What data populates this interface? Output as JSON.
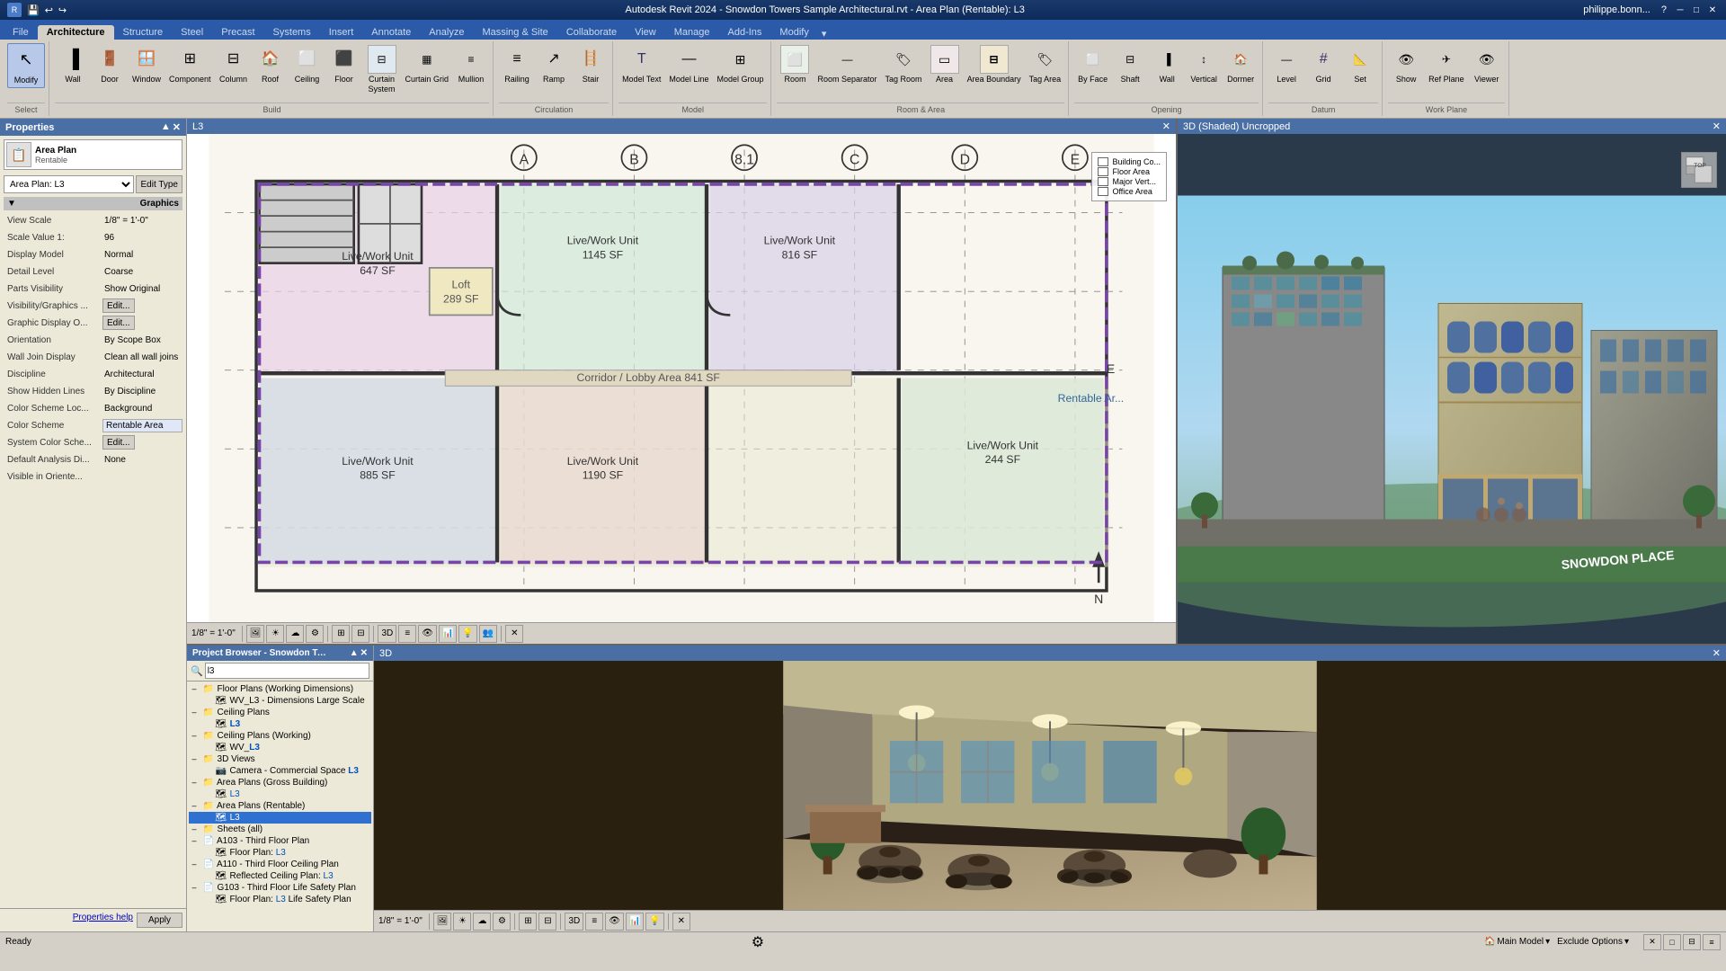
{
  "app": {
    "title": "Autodesk Revit 2024 - Snowdon Towers Sample Architectural.rvt - Area Plan (Rentable): L3",
    "user": "philippe.bonn...",
    "version": "2024"
  },
  "quick_toolbar": {
    "buttons": [
      "🖫",
      "📂",
      "💾",
      "↩",
      "↪",
      "?"
    ]
  },
  "ribbon": {
    "active_tab": "Architecture",
    "tabs": [
      "File",
      "Architecture",
      "Structure",
      "Steel",
      "Precast",
      "Systems",
      "Insert",
      "Annotate",
      "Analyze",
      "Massing & Site",
      "Collaborate",
      "View",
      "Manage",
      "Add-Ins",
      "Modify"
    ],
    "groups": {
      "select": {
        "label": "Select",
        "buttons": [
          {
            "icon": "↖",
            "label": "Modify"
          }
        ]
      },
      "build": {
        "label": "Build",
        "buttons": [
          {
            "icon": "🧱",
            "label": "Wall"
          },
          {
            "icon": "🚪",
            "label": "Door"
          },
          {
            "icon": "🪟",
            "label": "Window"
          },
          {
            "icon": "⊞",
            "label": "Component"
          },
          {
            "icon": "🏛",
            "label": "Column"
          },
          {
            "icon": "🏠",
            "label": "Roof"
          },
          {
            "icon": "⬜",
            "label": "Ceiling"
          },
          {
            "icon": "⬛",
            "label": "Floor"
          },
          {
            "icon": "⊟",
            "label": "Curtain System"
          },
          {
            "icon": "⊞",
            "label": "Curtain Grid"
          },
          {
            "icon": "▦",
            "label": "Mullion"
          }
        ]
      },
      "circulation": {
        "label": "Circulation",
        "buttons": [
          {
            "icon": "⊟",
            "label": "Railing"
          },
          {
            "icon": "↗",
            "label": "Ramp"
          },
          {
            "icon": "≡",
            "label": "Stair"
          }
        ]
      },
      "model": {
        "label": "Model",
        "buttons": [
          {
            "icon": "T",
            "label": "Model Text"
          },
          {
            "icon": "—",
            "label": "Model Line"
          },
          {
            "icon": "⊞",
            "label": "Model Group"
          }
        ]
      },
      "room_area": {
        "label": "Room & Area",
        "buttons": [
          {
            "icon": "⬜",
            "label": "Room"
          },
          {
            "icon": "🏠",
            "label": "Room Separator"
          },
          {
            "icon": "🏷",
            "label": "Tag Room"
          },
          {
            "icon": "▭",
            "label": "Area"
          },
          {
            "icon": "⊟",
            "label": "Area Boundary"
          },
          {
            "icon": "🏷",
            "label": "Tag Area"
          }
        ]
      },
      "opening": {
        "label": "Opening",
        "buttons": [
          {
            "icon": "⬜",
            "label": "By Face"
          },
          {
            "icon": "⊟",
            "label": "Shaft"
          },
          {
            "icon": "🧱",
            "label": "Wall"
          },
          {
            "icon": "↕",
            "label": "Vertical"
          },
          {
            "icon": "⬛",
            "label": "Dormer"
          }
        ]
      },
      "datum": {
        "label": "Datum",
        "buttons": [
          {
            "icon": "—",
            "label": "Level"
          },
          {
            "icon": "#",
            "label": "Grid"
          },
          {
            "icon": "📐",
            "label": "Set"
          }
        ]
      },
      "work_plane": {
        "label": "Work Plane",
        "buttons": [
          {
            "icon": "👁",
            "label": "Show"
          },
          {
            "icon": "✈",
            "label": "Ref Plane"
          },
          {
            "icon": "👁",
            "label": "Viewer"
          }
        ]
      }
    }
  },
  "properties": {
    "title": "Properties",
    "type_name": "Area Plan",
    "type_sub": "Rentable",
    "selector_label": "Area Plan: L3",
    "edit_type_btn": "Edit Type",
    "sections": {
      "graphics": {
        "label": "Graphics",
        "expanded": true,
        "rows": [
          {
            "label": "View Scale",
            "value": "1/8\" = 1'-0\""
          },
          {
            "label": "Scale Value  1:",
            "value": "96"
          },
          {
            "label": "Display Model",
            "value": "Normal"
          },
          {
            "label": "Detail Level",
            "value": "Coarse"
          },
          {
            "label": "Parts Visibility",
            "value": "Show Original"
          },
          {
            "label": "Visibility/Graphics ...",
            "value": "Edit..."
          },
          {
            "label": "Graphic Display O...",
            "value": "Edit..."
          },
          {
            "label": "Orientation",
            "value": "By Scope Box"
          },
          {
            "label": "Wall Join Display",
            "value": "Clean all wall joins"
          },
          {
            "label": "Discipline",
            "value": "Architectural"
          },
          {
            "label": "Show Hidden Lines",
            "value": "By Discipline"
          },
          {
            "label": "Color Scheme Loc...",
            "value": "Background"
          },
          {
            "label": "Color Scheme",
            "value": "Rentable Area"
          },
          {
            "label": "System Color Sche...",
            "value": "Edit..."
          },
          {
            "label": "Default Analysis Di...",
            "value": "None"
          },
          {
            "label": "Visible in Oriente...",
            "value": ""
          }
        ]
      }
    },
    "footer": {
      "apply_label": "Apply",
      "help_link": "Properties help"
    }
  },
  "plan_view": {
    "title": "L3",
    "scale": "1/8\" = 1'-0\"",
    "legend": {
      "items": [
        {
          "label": "Building Co...",
          "checked": false
        },
        {
          "label": "Floor Area",
          "checked": false
        },
        {
          "label": "Major Vert...",
          "checked": false
        },
        {
          "label": "Office Area",
          "checked": false
        }
      ]
    }
  },
  "view_3d_top": {
    "title": "3D (Shaded) Uncropped"
  },
  "project_browser": {
    "title": "Project Browser - Snowdon Towers Sample A...",
    "search_placeholder": "13",
    "tree": [
      {
        "indent": 0,
        "expand": "–",
        "icon": "📁",
        "label": "Floor Plans (Working Dimensions)",
        "selected": false
      },
      {
        "indent": 1,
        "expand": "",
        "icon": "🗺",
        "label": "WV_L3 - Dimensions Large Scale",
        "selected": false
      },
      {
        "indent": 0,
        "expand": "–",
        "icon": "📁",
        "label": "Ceiling Plans",
        "selected": false
      },
      {
        "indent": 1,
        "expand": "",
        "icon": "🗺",
        "label": "L3",
        "selected": false,
        "blue_tag": "L3"
      },
      {
        "indent": 0,
        "expand": "–",
        "icon": "📁",
        "label": "Ceiling Plans (Working)",
        "selected": false
      },
      {
        "indent": 1,
        "expand": "",
        "icon": "🗺",
        "label": "WV_L3",
        "selected": false
      },
      {
        "indent": 0,
        "expand": "–",
        "icon": "📁",
        "label": "3D Views",
        "selected": false
      },
      {
        "indent": 1,
        "expand": "",
        "icon": "📷",
        "label": "Camera - Commercial Space L3",
        "selected": false
      },
      {
        "indent": 0,
        "expand": "–",
        "icon": "📁",
        "label": "Area Plans (Gross Building)",
        "selected": false
      },
      {
        "indent": 1,
        "expand": "",
        "icon": "🗺",
        "label": "L3",
        "selected": false
      },
      {
        "indent": 0,
        "expand": "–",
        "icon": "📁",
        "label": "Area Plans (Rentable)",
        "selected": false
      },
      {
        "indent": 1,
        "expand": "",
        "icon": "🗺",
        "label": "L3",
        "selected": true
      },
      {
        "indent": 0,
        "expand": "–",
        "icon": "📁",
        "label": "Sheets (all)",
        "selected": false
      },
      {
        "indent": 0,
        "expand": "–",
        "icon": "📄",
        "label": "A103 - Third Floor Plan",
        "selected": false
      },
      {
        "indent": 1,
        "expand": "",
        "icon": "🗺",
        "label": "Floor Plan: L3",
        "selected": false
      },
      {
        "indent": 0,
        "expand": "–",
        "icon": "📄",
        "label": "A110 - Third Floor Ceiling Plan",
        "selected": false
      },
      {
        "indent": 1,
        "expand": "",
        "icon": "🗺",
        "label": "Reflected Ceiling Plan: L3",
        "selected": false
      },
      {
        "indent": 0,
        "expand": "–",
        "icon": "📄",
        "label": "G103 - Third Floor Life Safety Plan",
        "selected": false
      },
      {
        "indent": 1,
        "expand": "",
        "icon": "🗺",
        "label": "Floor Plan: L3 Life Safety Plan",
        "selected": false
      }
    ]
  },
  "bottom_3d": {
    "title": "3D"
  },
  "status_bar": {
    "ready": "Ready",
    "main_model_label": "Main Model",
    "exclude_options_label": "Exclude Options"
  },
  "view_toolbars": {
    "plan_scale": "1/8\" = 1'-0\""
  }
}
